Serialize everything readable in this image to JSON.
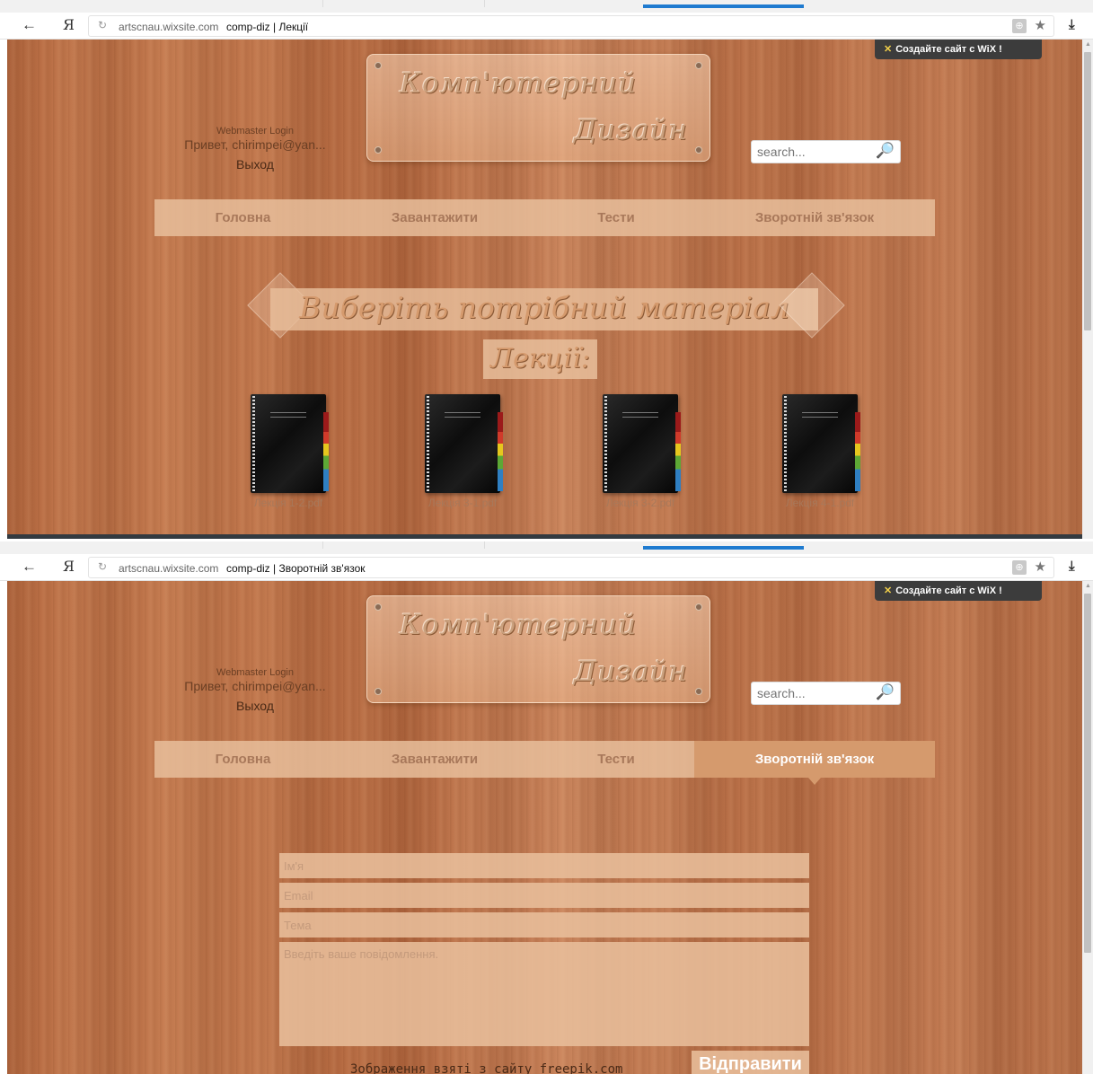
{
  "browser": {
    "back_glyph": "←",
    "yandex_glyph": "Я",
    "reload_glyph": "↻",
    "domain": "artscnau.wixsite.com",
    "ext_glyph": "⊕",
    "star_glyph": "★",
    "download_glyph": "⤓"
  },
  "screens": [
    {
      "url_title": "comp-diz | Лекції"
    },
    {
      "url_title": "comp-diz | Зворотній зв'язок"
    }
  ],
  "site": {
    "wix_badge": "Создайте сайт с WiX !",
    "wix_icon_glyph": "✕",
    "webmaster_login": "Webmaster Login",
    "greeting": "Привет, chirimpei@yan...",
    "logout": "Выход",
    "logo_line1": "Комп'ютерний",
    "logo_line2": "Дизайн",
    "search_placeholder": "search...",
    "search_glyph": "🔍",
    "nav": [
      {
        "label": "Головна"
      },
      {
        "label": "Завантажити"
      },
      {
        "label": "Тести"
      },
      {
        "label": "Зворотній зв'язок"
      }
    ]
  },
  "lectures_page": {
    "banner": "Виберіть потрібний матеріал",
    "subbanner": "Лекції:",
    "files": [
      {
        "name": "Лекція 1-2.pdf"
      },
      {
        "name": "Лекція 3-1.pdf"
      },
      {
        "name": "Лекція 3-2.pdf"
      },
      {
        "name": "Лекція 4-1.pdf"
      }
    ]
  },
  "contact_page": {
    "active_nav": "Зворотній зв'язок",
    "name_placeholder": "Ім'я",
    "email_placeholder": "Email",
    "subject_placeholder": "Тема",
    "message_placeholder": "Введіть ваше повідомлення.",
    "send_label": "Відправити",
    "credit": "Зображення взяті з сайту freepik.com"
  },
  "colors": {
    "nav_active": "#d59a6d",
    "nav_text": "#a8785a",
    "tab_active_line": "#1f7bd0"
  }
}
